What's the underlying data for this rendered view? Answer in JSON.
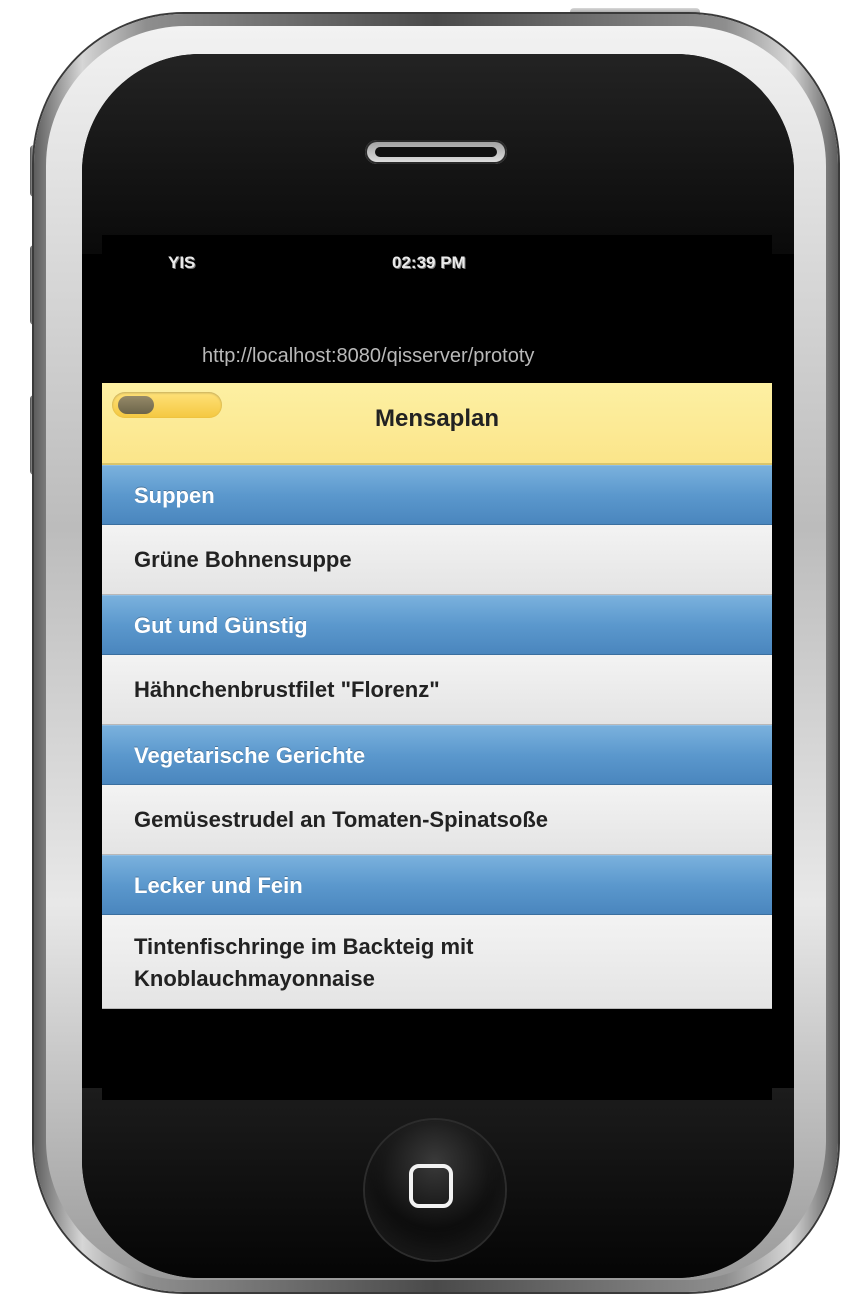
{
  "status_bar": {
    "carrier": "YIS",
    "time": "02:39 PM"
  },
  "browser": {
    "url": "http://localhost:8080/qisserver/prototy"
  },
  "app": {
    "title": "Mensaplan",
    "toggle_state": "off"
  },
  "menu": [
    {
      "category": "Suppen",
      "dish": "Grüne Bohnensuppe"
    },
    {
      "category": "Gut und Günstig",
      "dish": "Hähnchenbrustfilet \"Florenz\""
    },
    {
      "category": "Vegetarische Gerichte",
      "dish": "Gemüsestrudel an Tomaten-Spinatsoße"
    },
    {
      "category": "Lecker und Fein",
      "dish_line1": "Tintenfischringe im Backteig mit",
      "dish_line2": "Knoblauchmayonnaise"
    }
  ],
  "colors": {
    "header": "#fbe58a",
    "category_row": "#5b98cd",
    "dish_row": "#e4e4e4"
  },
  "icons": [
    "speaker-grille",
    "home-button-icon"
  ]
}
